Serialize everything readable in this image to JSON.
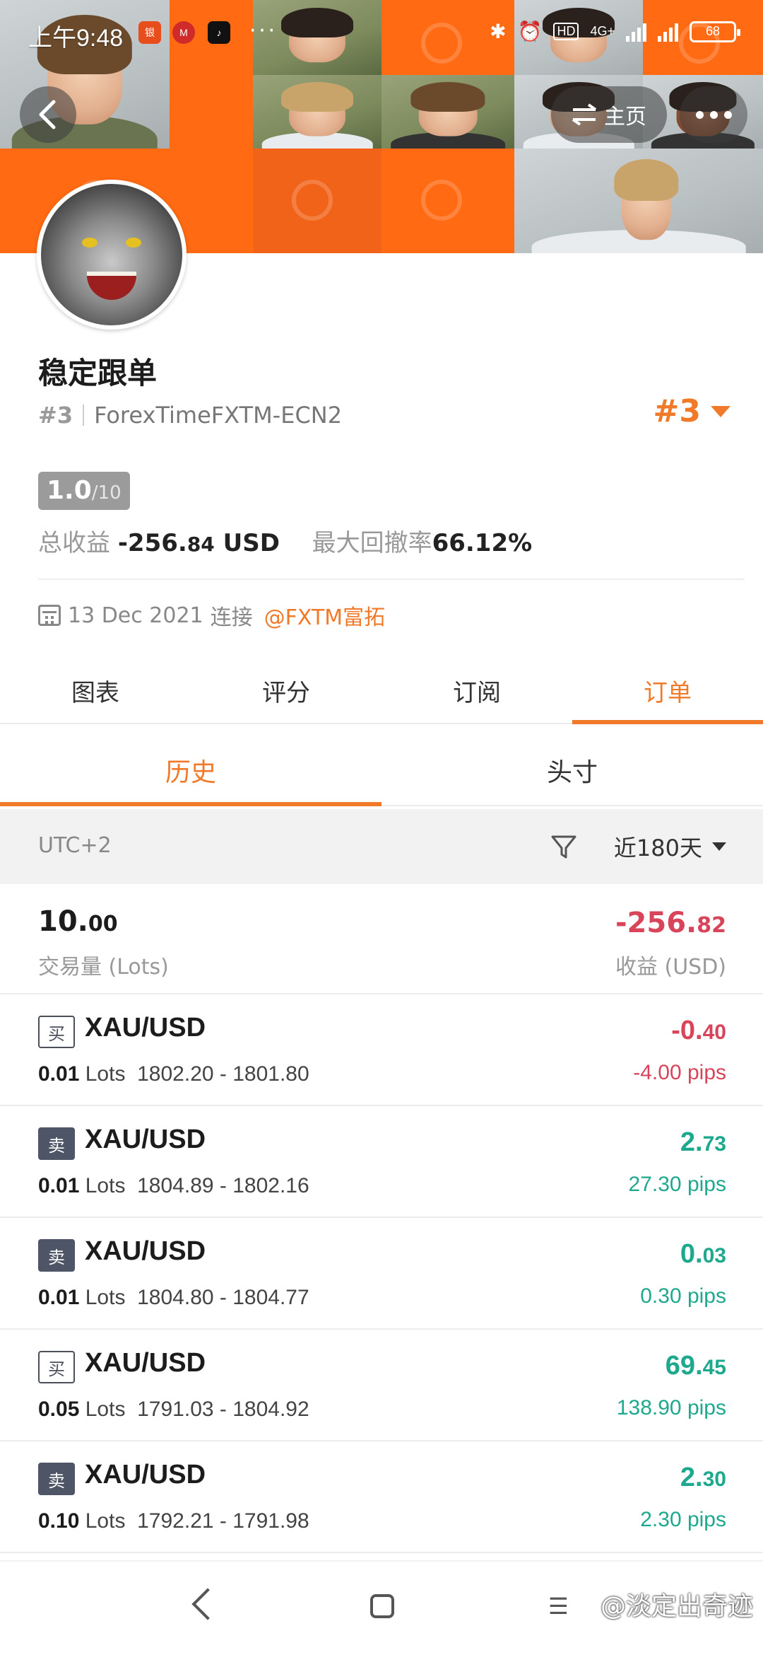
{
  "status_bar": {
    "time": "上午9:48",
    "app_icons": [
      "bank-app-icon",
      "cmb-app-icon",
      "tiktok-icon"
    ],
    "more": "···",
    "network": "4G+",
    "battery": "68"
  },
  "header": {
    "home_label": "主页",
    "accent_color": "#ff6a13"
  },
  "profile": {
    "name": "稳定跟单",
    "rank_hash": "#3",
    "server": "ForexTimeFXTM-ECN2",
    "rank_right": "#3",
    "score": "1.0",
    "score_max": "/10",
    "total_profit_label": "总收益",
    "total_profit_int": "-256.",
    "total_profit_dec": "84",
    "total_profit_unit": "USD",
    "max_drawdown_label": "最大回撤率",
    "max_drawdown": "66.12%",
    "connected_date": "13 Dec 2021",
    "connected_label": "连接",
    "broker": "@FXTM富拓"
  },
  "tabs": [
    "图表",
    "评分",
    "订阅",
    "订单"
  ],
  "active_tab": 3,
  "subtabs": [
    "历史",
    "头寸"
  ],
  "active_subtab": 0,
  "filter": {
    "timezone": "UTC+2",
    "period": "近180天"
  },
  "summary": {
    "lots_int": "10.",
    "lots_dec": "00",
    "lots_label": "交易量 (Lots)",
    "profit_int": "-256.",
    "profit_dec": "82",
    "profit_label": "收益 (USD)"
  },
  "orders": [
    {
      "side": "买",
      "type": "buy",
      "symbol": "XAU/USD",
      "lots": "0.01",
      "lots_unit": "Lots",
      "prices": "1802.20 - 1801.80",
      "profit_int": "-0.",
      "profit_dec": "40",
      "pips": "-4.00 pips",
      "sign": "neg"
    },
    {
      "side": "卖",
      "type": "sell",
      "symbol": "XAU/USD",
      "lots": "0.01",
      "lots_unit": "Lots",
      "prices": "1804.89 - 1802.16",
      "profit_int": "2.",
      "profit_dec": "73",
      "pips": "27.30 pips",
      "sign": "pos"
    },
    {
      "side": "卖",
      "type": "sell",
      "symbol": "XAU/USD",
      "lots": "0.01",
      "lots_unit": "Lots",
      "prices": "1804.80 - 1804.77",
      "profit_int": "0.",
      "profit_dec": "03",
      "pips": "0.30 pips",
      "sign": "pos"
    },
    {
      "side": "买",
      "type": "buy",
      "symbol": "XAU/USD",
      "lots": "0.05",
      "lots_unit": "Lots",
      "prices": "1791.03 - 1804.92",
      "profit_int": "69.",
      "profit_dec": "45",
      "pips": "138.90 pips",
      "sign": "pos"
    },
    {
      "side": "卖",
      "type": "sell",
      "symbol": "XAU/USD",
      "lots": "0.10",
      "lots_unit": "Lots",
      "prices": "1792.21 - 1791.98",
      "profit_int": "2.",
      "profit_dec": "30",
      "pips": "2.30 pips",
      "sign": "pos"
    }
  ],
  "watermark": "@淡定出奇迹",
  "colors": {
    "accent": "#f07a2a",
    "negative": "#d8455a",
    "positive": "#1ea88e"
  }
}
